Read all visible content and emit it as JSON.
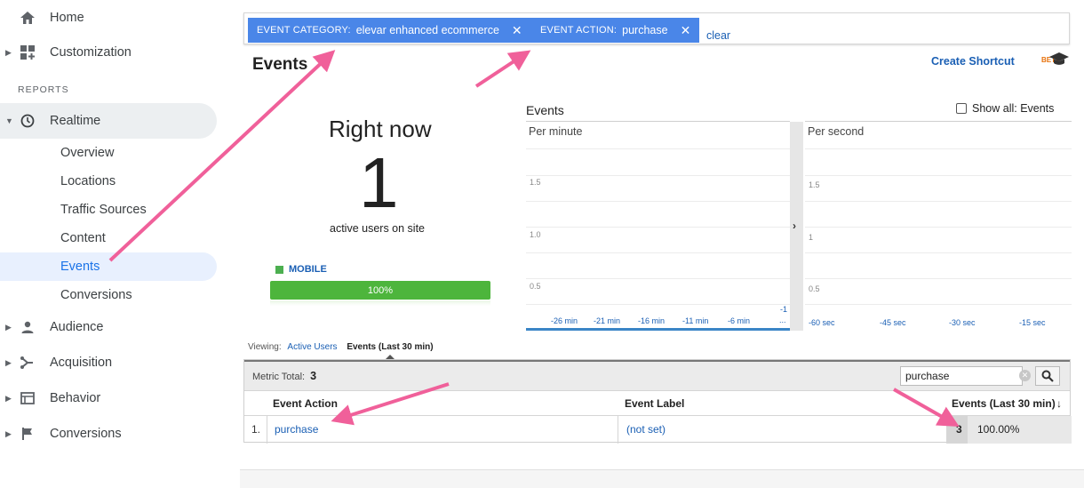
{
  "sidebar": {
    "home": "Home",
    "customization": "Customization",
    "reports_heading": "REPORTS",
    "realtime": "Realtime",
    "realtime_items": [
      "Overview",
      "Locations",
      "Traffic Sources",
      "Content",
      "Events",
      "Conversions"
    ],
    "audience": "Audience",
    "acquisition": "Acquisition",
    "behavior": "Behavior",
    "conversions": "Conversions"
  },
  "filters": {
    "chip1_key": "EVENT CATEGORY:",
    "chip1_value": "elevar enhanced ecommerce",
    "chip2_key": "EVENT ACTION:",
    "chip2_value": "purchase",
    "clear": "clear"
  },
  "header": {
    "title": "Events",
    "create_shortcut": "Create Shortcut",
    "beta": "BETA"
  },
  "right_now": {
    "label": "Right now",
    "value": "1",
    "caption": "active users on site",
    "device_label": "MOBILE",
    "device_percent": "100%",
    "device_fraction": 1.0
  },
  "events_chart": {
    "title": "Events",
    "show_all": "Show all: Events",
    "per_minute": {
      "title": "Per minute",
      "y_ticks": [
        "1.5",
        "1.0",
        "0.5"
      ],
      "x_ticks": [
        "-26 min",
        "-21 min",
        "-16 min",
        "-11 min",
        "-6 min",
        "-1"
      ],
      "x_trailing": "..."
    },
    "per_second": {
      "title": "Per second",
      "y_ticks": [
        "1.5",
        "1",
        "0.5"
      ],
      "x_ticks": [
        "-60 sec",
        "-45 sec",
        "-30 sec",
        "-15 sec"
      ]
    }
  },
  "viewing": {
    "prefix": "Viewing:",
    "option1": "Active Users",
    "option2": "Events (Last 30 min)"
  },
  "table": {
    "metric_total_label": "Metric Total:",
    "metric_total_value": "3",
    "search_value": "purchase",
    "columns": [
      "Event Action",
      "Event Label",
      "Events (Last 30 min)"
    ],
    "sort_indicator": "↓",
    "rows": [
      {
        "num": "1.",
        "action": "purchase",
        "label": "(not set)",
        "events": "3",
        "percent": "100.00%"
      }
    ]
  },
  "colors": {
    "chip_blue": "#4a86e8",
    "link_blue": "#1a5fb4",
    "mobile_green": "#4db53c",
    "arrow_pink": "#f0609a"
  }
}
